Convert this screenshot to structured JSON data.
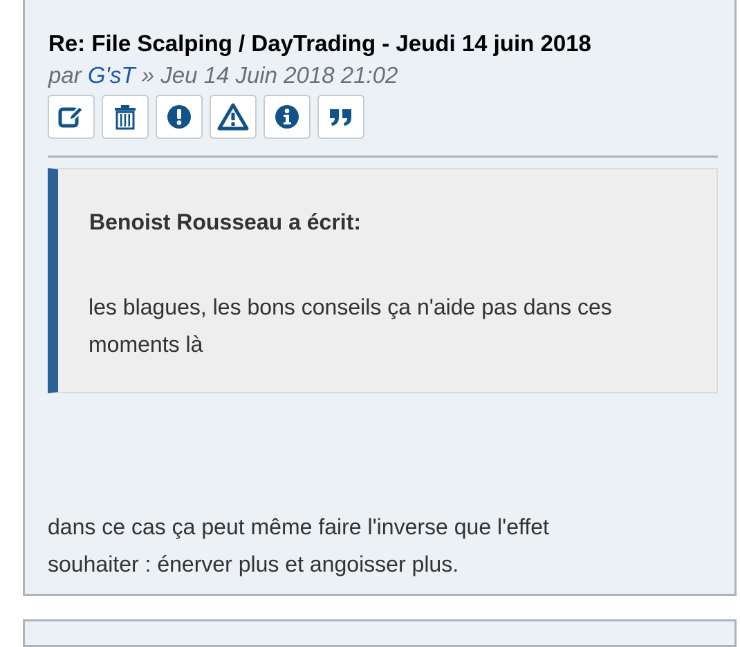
{
  "post": {
    "title": "Re: File Scalping / DayTrading - Jeudi 14 juin 2018",
    "byline": {
      "prefix": "par ",
      "author": "G'sT",
      "separator": " » ",
      "date": "Jeu 14 Juin 2018 21:02"
    },
    "actions": [
      {
        "name": "edit",
        "icon": "edit-icon"
      },
      {
        "name": "delete",
        "icon": "trash-icon"
      },
      {
        "name": "report",
        "icon": "exclamation-circle-icon"
      },
      {
        "name": "warn",
        "icon": "warning-triangle-icon"
      },
      {
        "name": "info",
        "icon": "info-circle-icon"
      },
      {
        "name": "quote",
        "icon": "quote-icon"
      }
    ],
    "quote": {
      "cite": "Benoist Rousseau a écrit:",
      "text": "les blagues, les bons conseils ça n'aide pas dans ces moments là"
    },
    "body_lines": [
      "dans ce cas ça peut même faire l'inverse que l'effet",
      "souhaiter : énerver plus et angoisser plus."
    ]
  },
  "colors": {
    "post_background": "#ecf1f5",
    "post_border": "#aeb4b9",
    "icon_blue": "#105289",
    "author_link": "#1a56b2",
    "quote_bar": "#2d6299",
    "quote_background": "#eeeeee"
  }
}
